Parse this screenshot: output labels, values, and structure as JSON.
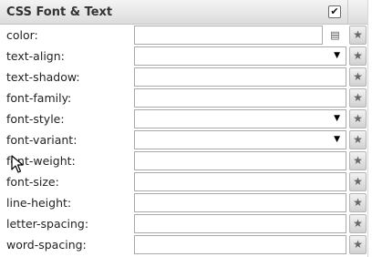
{
  "panel": {
    "title": "CSS Font & Text",
    "enabled_checkbox": "✔"
  },
  "icons": {
    "star": "★",
    "list": "▤",
    "dropdown": "▼"
  },
  "properties": [
    {
      "label": "color:",
      "control": "color",
      "value": ""
    },
    {
      "label": "text-align:",
      "control": "select",
      "value": ""
    },
    {
      "label": "text-shadow:",
      "control": "text",
      "value": ""
    },
    {
      "label": "font-family:",
      "control": "text",
      "value": ""
    },
    {
      "label": "font-style:",
      "control": "select",
      "value": ""
    },
    {
      "label": "font-variant:",
      "control": "select",
      "value": ""
    },
    {
      "label": "font-weight:",
      "control": "text",
      "value": ""
    },
    {
      "label": "font-size:",
      "control": "text",
      "value": ""
    },
    {
      "label": "line-height:",
      "control": "text",
      "value": ""
    },
    {
      "label": "letter-spacing:",
      "control": "text",
      "value": ""
    },
    {
      "label": "word-spacing:",
      "control": "text",
      "value": ""
    }
  ]
}
